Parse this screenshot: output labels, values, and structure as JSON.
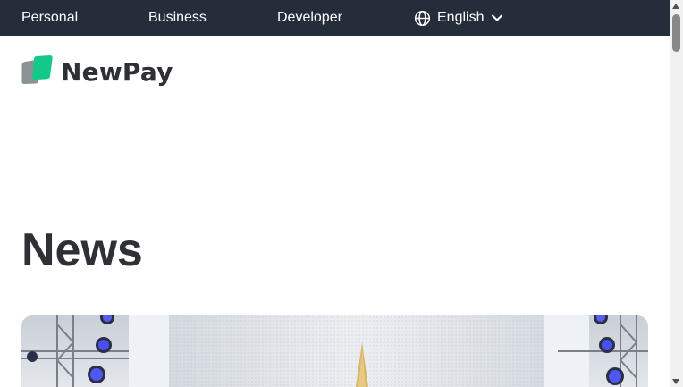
{
  "topbar": {
    "nav": [
      {
        "label": "Personal"
      },
      {
        "label": "Business"
      },
      {
        "label": "Developer"
      }
    ],
    "language": {
      "icon": "globe-icon",
      "label": "English",
      "caret_icon": "chevron-down-icon"
    }
  },
  "brand": {
    "name": "NewPay",
    "primary_color": "#14c889",
    "secondary_color": "#8a9296",
    "text_color": "#2f3035"
  },
  "page": {
    "heading": "News"
  },
  "colors": {
    "topbar_bg": "#252c3a"
  }
}
